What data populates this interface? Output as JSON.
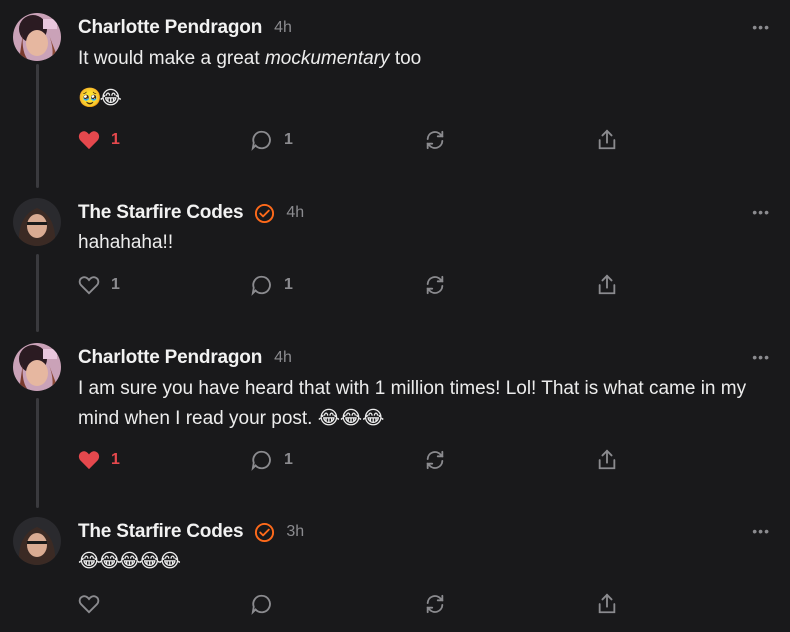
{
  "colors": {
    "background": "#19191b",
    "like_active": "#e5484d",
    "verified": "#ff6a1a",
    "muted": "#8b8b8f"
  },
  "comments": [
    {
      "author": "Charlotte Pendragon",
      "verified": false,
      "time": "4h",
      "text_before": "It would make a great ",
      "text_italic": "mockumentary",
      "text_after": " too",
      "emoji_line": "🥹😂",
      "likes": "1",
      "liked": true,
      "replies": "1"
    },
    {
      "author": "The Starfire Codes",
      "verified": true,
      "time": "4h",
      "text": "hahahaha!!",
      "likes": "1",
      "liked": false,
      "replies": "1"
    },
    {
      "author": "Charlotte Pendragon",
      "verified": false,
      "time": "4h",
      "text": "I am sure you have heard that with 1 million times! Lol! That is what came in my mind when I read your post. 😂😂😂",
      "likes": "1",
      "liked": true,
      "replies": "1"
    },
    {
      "author": "The Starfire Codes",
      "verified": true,
      "time": "3h",
      "text": "😂😂😂😂😂",
      "likes": "",
      "liked": false,
      "replies": ""
    }
  ],
  "icons": {
    "like": "heart-icon",
    "reply": "comment-bubble-icon",
    "restack": "restack-icon",
    "share": "share-icon",
    "more": "more-dots-icon",
    "verified": "verified-check-icon"
  }
}
